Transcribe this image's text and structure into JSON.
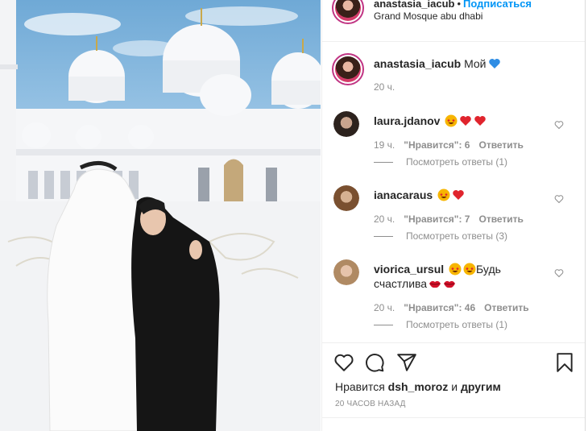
{
  "post": {
    "username": "anastasia_iacub",
    "separator": "•",
    "follow_label": "Подписаться",
    "location": "Grand Mosque abu dhabi"
  },
  "caption": {
    "username": "anastasia_iacub",
    "text": "Мой",
    "emoji": [
      "blue-heart"
    ],
    "time": "20 ч."
  },
  "comments": [
    {
      "username": "laura.jdanov",
      "text": "",
      "emoji": [
        "star-struck",
        "red-heart",
        "red-heart"
      ],
      "time": "19 ч.",
      "likes": "\"Нравится\": 6",
      "reply": "Ответить",
      "view_replies": "Посмотреть ответы (1)"
    },
    {
      "username": "ianacaraus",
      "text": "",
      "emoji": [
        "star-struck",
        "red-heart"
      ],
      "time": "20 ч.",
      "likes": "\"Нравится\": 7",
      "reply": "Ответить",
      "view_replies": "Посмотреть ответы (3)"
    },
    {
      "username": "viorica_ursul",
      "text_before": "",
      "text": "Будь счастлива",
      "emoji_before": [
        "star-struck",
        "star-struck"
      ],
      "emoji": [
        "lips",
        "lips"
      ],
      "time": "20 ч.",
      "likes": "\"Нравится\": 46",
      "reply": "Ответить",
      "view_replies": "Посмотреть ответы (1)"
    }
  ],
  "actions": {
    "icons": [
      "heart-outline-icon",
      "comment-icon",
      "share-icon",
      "bookmark-icon"
    ],
    "likes_prefix": "Нравится",
    "likes_user": "dsh_moroz",
    "likes_suffix": "и",
    "likes_others": "другим",
    "posted": "20 ЧАСОВ НАЗАД"
  },
  "colors": {
    "accent": "#0095f6",
    "muted": "#8e8e8e",
    "ring": "#c13584",
    "heart": "#ed4956"
  }
}
